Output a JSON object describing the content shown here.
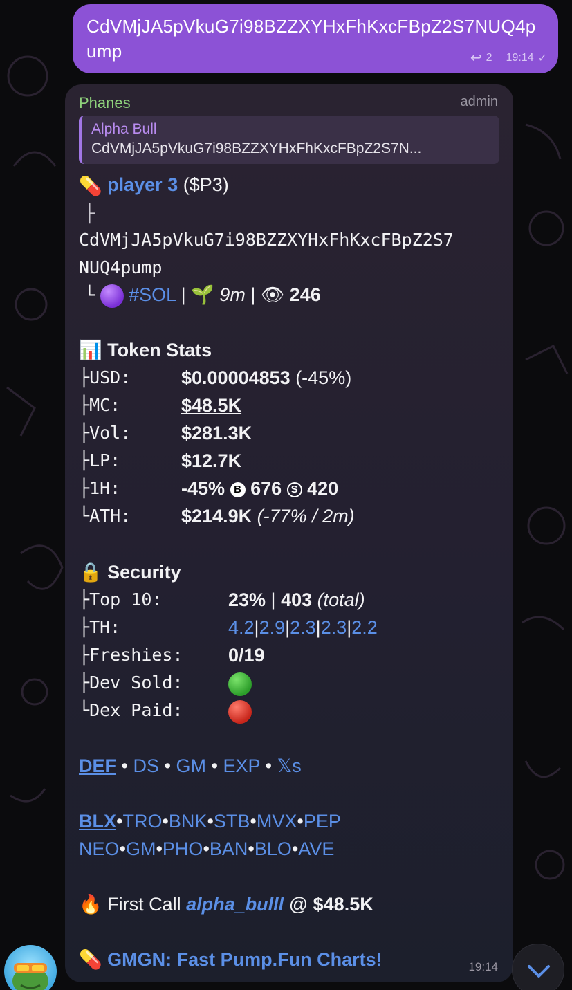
{
  "outgoing": {
    "text": "CdVMjJA5pVkuG7i98BZZXYHxFhKxcFBpZ2S7NUQ4pump",
    "reply_count": "2",
    "time": "19:14"
  },
  "incoming": {
    "sender": "Phanes",
    "role": "admin",
    "quote": {
      "name": "Alpha Bull",
      "text": "CdVMjJA5pVkuG7i98BZZXYHxFhKxcFBpZ2S7N..."
    },
    "token": {
      "name": "player 3",
      "ticker": "($P3)",
      "address_line1": "CdVMjJA5pVkuG7i98BZZXYHxFhKxcFBpZ2S7",
      "address_line2": "NUQ4pump",
      "chain": "#SOL",
      "age": "9m",
      "views": "246"
    },
    "token_stats": {
      "heading": "Token Stats",
      "rows": [
        {
          "key": "USD:",
          "value": "$0.00004853",
          "extra": "(-45%)"
        },
        {
          "key": "MC:",
          "value": "$48.5K"
        },
        {
          "key": "Vol:",
          "value": "$281.3K"
        },
        {
          "key": "LP:",
          "value": "$12.7K"
        },
        {
          "key": "1H:",
          "value": "-45%",
          "buys": "676",
          "sells": "420"
        },
        {
          "key": "ATH:",
          "value": "$214.9K",
          "extra": "(-77% / 2m)"
        }
      ]
    },
    "security": {
      "heading": "Security",
      "top10_key": "Top 10:",
      "top10_value": "23%",
      "top10_total": "403",
      "top10_total_label": "(total)",
      "th_key": "TH:",
      "th_values": [
        "4.2",
        "2.9",
        "2.3",
        "2.3",
        "2.2"
      ],
      "freshies_key": "Freshies:",
      "freshies_value": "0/19",
      "dev_sold_key": "Dev Sold:",
      "dex_paid_key": "Dex Paid:"
    },
    "links_row1": [
      "DEF",
      "DS",
      "GM",
      "EXP",
      "𝕏s"
    ],
    "links_row2": [
      "BLX",
      "TRO",
      "BNK",
      "STB",
      "MVX",
      "PEP"
    ],
    "links_row3": [
      "NEO",
      "GM",
      "PHO",
      "BAN",
      "BLO",
      "AVE"
    ],
    "first_call": {
      "label": "First Call",
      "user": "alpha_bulll",
      "at": "@",
      "price": "$48.5K"
    },
    "promo": "GMGN: Fast Pump.Fun Charts!",
    "time": "19:14"
  },
  "colors": {
    "outgoing_bubble": "#8c52d6",
    "link": "#5b8fe6",
    "sender": "#8fd27c"
  }
}
